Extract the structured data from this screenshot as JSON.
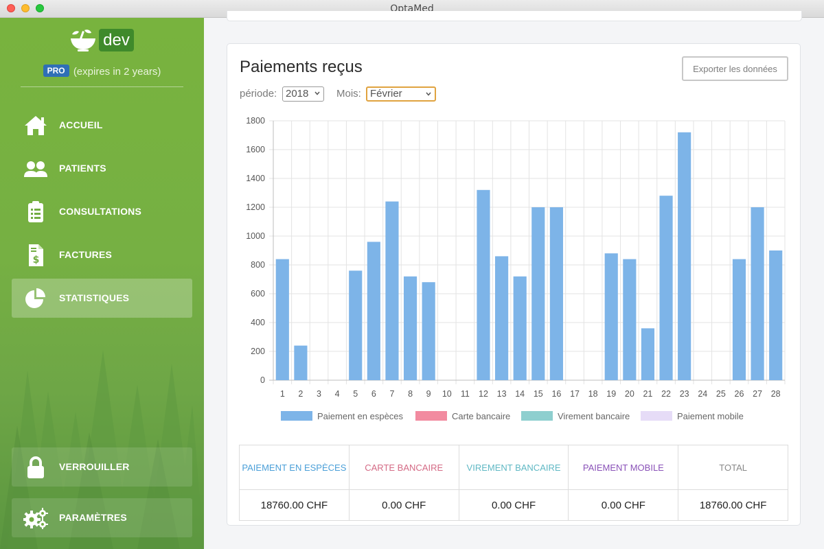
{
  "window": {
    "title": "OptaMed"
  },
  "sidebar": {
    "logo_text": "dev",
    "badge": "PRO",
    "license_text": "(expires in 2 years)",
    "items": [
      {
        "label": "ACCUEIL",
        "icon": "home-icon",
        "active": false
      },
      {
        "label": "PATIENTS",
        "icon": "users-icon",
        "active": false
      },
      {
        "label": "CONSULTATIONS",
        "icon": "clipboard-icon",
        "active": false
      },
      {
        "label": "FACTURES",
        "icon": "invoice-icon",
        "active": false
      },
      {
        "label": "STATISTIQUES",
        "icon": "pie-chart-icon",
        "active": true
      }
    ],
    "bottom_items": [
      {
        "label": "VERROUILLER",
        "icon": "lock-icon"
      },
      {
        "label": "PARAMÈTRES",
        "icon": "gears-icon"
      }
    ],
    "colors": {
      "green": "#76b043",
      "dev_badge": "#3f8a2b",
      "pro_badge": "#2f6fb6"
    }
  },
  "card": {
    "title": "Paiements reçus",
    "export_label": "Exporter les données",
    "period_label": "période:",
    "period_value": "2018",
    "month_label": "Mois:",
    "month_value": "Février"
  },
  "chart_data": {
    "type": "bar",
    "categories": [
      "1",
      "2",
      "3",
      "4",
      "5",
      "6",
      "7",
      "8",
      "9",
      "10",
      "11",
      "12",
      "13",
      "14",
      "15",
      "16",
      "17",
      "18",
      "19",
      "20",
      "21",
      "22",
      "23",
      "24",
      "25",
      "26",
      "27",
      "28"
    ],
    "series": [
      {
        "name": "Paiement en espèces",
        "color": "#7db4e8",
        "values": [
          840,
          240,
          0,
          0,
          760,
          960,
          1240,
          720,
          680,
          0,
          0,
          1320,
          860,
          720,
          1200,
          1200,
          0,
          0,
          880,
          840,
          360,
          1280,
          1720,
          0,
          0,
          840,
          1200,
          900
        ]
      },
      {
        "name": "Carte bancaire",
        "color": "#f28ba0",
        "values": [
          0,
          0,
          0,
          0,
          0,
          0,
          0,
          0,
          0,
          0,
          0,
          0,
          0,
          0,
          0,
          0,
          0,
          0,
          0,
          0,
          0,
          0,
          0,
          0,
          0,
          0,
          0,
          0
        ]
      },
      {
        "name": "Virement bancaire",
        "color": "#8ecfcf",
        "values": [
          0,
          0,
          0,
          0,
          0,
          0,
          0,
          0,
          0,
          0,
          0,
          0,
          0,
          0,
          0,
          0,
          0,
          0,
          0,
          0,
          0,
          0,
          0,
          0,
          0,
          0,
          0,
          0
        ]
      },
      {
        "name": "Paiement mobile",
        "color": "#e6dcf7",
        "values": [
          0,
          0,
          0,
          0,
          0,
          0,
          0,
          0,
          0,
          0,
          0,
          0,
          0,
          0,
          0,
          0,
          0,
          0,
          0,
          0,
          0,
          0,
          0,
          0,
          0,
          0,
          0,
          0
        ]
      }
    ],
    "yticks": [
      "0",
      "200",
      "400",
      "600",
      "800",
      "1000",
      "1200",
      "1400",
      "1600",
      "1800"
    ],
    "ylim": [
      0,
      1800
    ],
    "grid": true,
    "legend": "bottom"
  },
  "summary": {
    "headers": [
      {
        "label": "Paiement en espèces",
        "color": "#4a9fd8"
      },
      {
        "label": "Carte bancaire",
        "color": "#d46a85"
      },
      {
        "label": "Virement bancaire",
        "color": "#5fb8c4"
      },
      {
        "label": "Paiement mobile",
        "color": "#8a52b8"
      },
      {
        "label": "Total",
        "color": "#888888"
      }
    ],
    "values": [
      "18760.00 CHF",
      "0.00 CHF",
      "0.00 CHF",
      "0.00 CHF",
      "18760.00 CHF"
    ]
  }
}
